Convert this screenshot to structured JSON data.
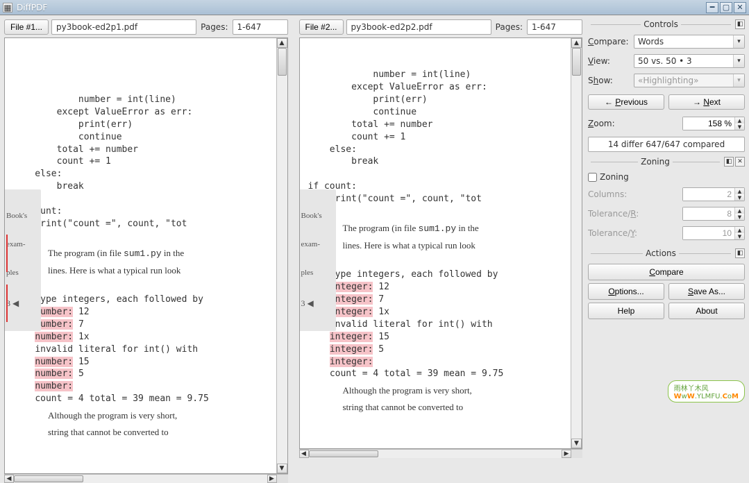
{
  "app": {
    "title": "DiffPDF"
  },
  "file1": {
    "button": "File #1...",
    "name": "py3book-ed2p1.pdf",
    "pages_label": "Pages:",
    "pages": "1-647"
  },
  "file2": {
    "button": "File #2...",
    "name": "py3book-ed2p2.pdf",
    "pages_label": "Pages:",
    "pages": "1-647"
  },
  "doc": {
    "code1": "            number = int(line)\n        except ValueError as err:\n            print(err)\n            continue\n        total += number\n        count += 1\n    else:\n        break\n\nif count:\n    print(\"count =\", count, \"tot",
    "prose1a": "The program (in file ",
    "prose1_file": "sum1.py",
    "prose1b": " in the ",
    "prose1c": "lines.  Here is what a typical run look",
    "sample_intro": "Type integers, each followed by ",
    "left_word": "number:",
    "right_word": "integer:",
    "vals": [
      "12",
      "7",
      "1x"
    ],
    "invalid": "invalid literal for int() with ",
    "vals2": [
      "15",
      "5",
      ""
    ],
    "summary": "count = 4 total = 39 mean = 9.75",
    "prose2a": "Although the program is very short,",
    "prose2b": "string that cannot be converted to ",
    "margin": {
      "l1": "Book's",
      "l2": "exam-",
      "l3": "ples",
      "nav": "3 ◀"
    }
  },
  "controls": {
    "title": "Controls",
    "compare_label": "Compare:",
    "compare_value": "Words",
    "view_label": "View:",
    "view_value": "50 vs. 50 • 3",
    "show_label": "Show:",
    "show_value": "«Highlighting»",
    "prev": "Previous",
    "next": "Next",
    "zoom_label": "Zoom:",
    "zoom_value": "158 %",
    "status": "14 differ 647/647 compared"
  },
  "zoning": {
    "title": "Zoning",
    "checkbox": "Zoning",
    "columns_label": "Columns:",
    "columns": "2",
    "tolr_label": "Tolerance/R:",
    "tolr": "8",
    "toly_label": "Tolerance/Y:",
    "toly": "10"
  },
  "actions": {
    "title": "Actions",
    "compare": "Compare",
    "options": "Options...",
    "saveas": "Save As...",
    "help": "Help",
    "about": "About"
  },
  "watermark": {
    "line1": "雨林丫木风",
    "line2": "WwW.YLMFU.CoM"
  }
}
